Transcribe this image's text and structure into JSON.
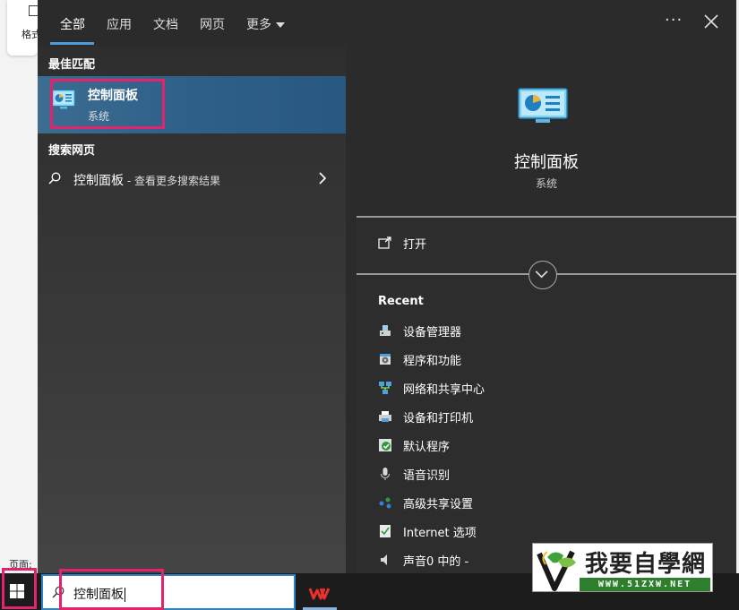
{
  "background": {
    "card_label": "格式",
    "page_label": "页面:"
  },
  "menu": {
    "tabs": [
      {
        "label": "全部",
        "active": true
      },
      {
        "label": "应用",
        "active": false
      },
      {
        "label": "文档",
        "active": false
      },
      {
        "label": "网页",
        "active": false
      },
      {
        "label": "更多",
        "active": false
      }
    ],
    "more_options_label": "···",
    "accent_color": "#4d9bdb",
    "highlight_color": "#e2246d"
  },
  "best_match": {
    "section_label": "最佳匹配",
    "title": "控制面板",
    "subtitle": "系统",
    "icon": "control-panel-icon"
  },
  "web_search": {
    "section_label": "搜索网页",
    "query": "控制面板",
    "suffix": " - 查看更多搜索结果"
  },
  "detail": {
    "title": "控制面板",
    "subtitle": "系统",
    "open_label": "打开",
    "recent_title": "Recent",
    "recent": [
      {
        "label": "设备管理器",
        "icon": "device-manager-icon"
      },
      {
        "label": "程序和功能",
        "icon": "programs-features-icon"
      },
      {
        "label": "网络和共享中心",
        "icon": "network-center-icon"
      },
      {
        "label": "设备和打印机",
        "icon": "printer-icon"
      },
      {
        "label": "默认程序",
        "icon": "default-programs-icon"
      },
      {
        "label": "语音识别",
        "icon": "microphone-icon"
      },
      {
        "label": "高级共享设置",
        "icon": "sharing-settings-icon"
      },
      {
        "label": "Internet 选项",
        "icon": "internet-options-icon"
      },
      {
        "label": "声音0 中的 -",
        "icon": "speaker-icon"
      }
    ]
  },
  "taskbar": {
    "search_value": "控制面板"
  },
  "watermark": {
    "brand": "我要自學網",
    "url": "WWW.51ZXW.NET"
  }
}
